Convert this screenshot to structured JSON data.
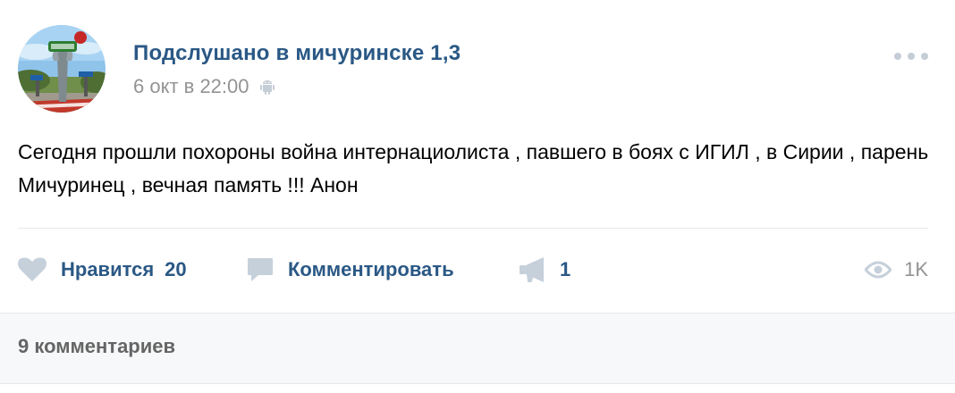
{
  "post": {
    "author": "Подслушано в мичуринске 1,3",
    "date": "6 окт в 22:00",
    "platform_icon": "android-icon",
    "text": "Сегодня прошли похороны война интернациолиста , павшего в боях с ИГИЛ , в Сирии , парень Мичуринец , вечная память !!! Анон"
  },
  "actions": {
    "like_label": "Нравится",
    "like_count": "20",
    "comment_label": "Комментировать",
    "share_count": "1",
    "views_count": "1K"
  },
  "footer": {
    "comments_label": "9 комментариев"
  },
  "colors": {
    "link": "#2a5885",
    "secondary": "#939393",
    "icon": "#c5d0db",
    "divider": "#e7e8ec",
    "footer_bg": "#f7f8fa"
  }
}
